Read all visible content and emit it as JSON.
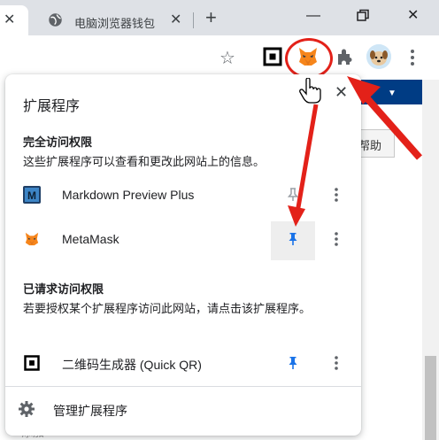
{
  "tabs": [
    {
      "title": ""
    },
    {
      "title": "电脑浏览器钱包"
    }
  ],
  "popup": {
    "title": "扩展程序",
    "sections": [
      {
        "title": "完全访问权限",
        "description": "这些扩展程序可以查看和更改此网站上的信息。",
        "items": [
          {
            "name": "Markdown Preview Plus",
            "icon": "markdown-icon",
            "pinned": false
          },
          {
            "name": "MetaMask",
            "icon": "fox-icon",
            "pinned": true
          }
        ]
      },
      {
        "title": "已请求访问权限",
        "description": "若要授权某个扩展程序访问此网站，请点击该扩展程序。",
        "items": [
          {
            "name": "二维码生成器 (Quick QR)",
            "icon": "qr-code-icon",
            "pinned": true
          }
        ]
      }
    ],
    "footer": {
      "label": "管理扩展程序"
    }
  },
  "background": {
    "button_label": "帮助",
    "bottom_text": "添加"
  },
  "colors": {
    "accent_pin": "#1a73e8",
    "annotation": "#e32119",
    "metamask": "#f6851b"
  }
}
